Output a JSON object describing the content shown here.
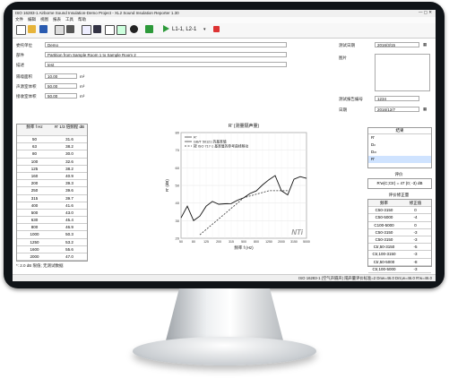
{
  "window": {
    "title": "ISO 16283-1 Airborne Sound Insulation-Demo Project - XL2 Sound Insulation Reporter 1.30"
  },
  "menu": [
    "文件",
    "编辑",
    "视图",
    "报表",
    "工具",
    "帮助"
  ],
  "toolbar": {
    "pair_label": "L1-1, L2-1"
  },
  "form": {
    "org_label": "委托单位",
    "org_value": "Demo",
    "part_label": "部件",
    "part_value": "Partition from Sample Room 1 to Sample Room 2",
    "note_label": "描述",
    "note_value": "test",
    "area_label": "隔墙面积",
    "area_value": "10.00",
    "area_unit": "m²",
    "src_vol_label": "声源室体积",
    "src_vol_value": "50.00",
    "src_vol_unit": "m³",
    "rcv_vol_label": "接收室体积",
    "rcv_vol_value": "50.00",
    "rcv_vol_unit": "m³",
    "test_date_label": "测试日期",
    "test_date_value": "2016/3/15",
    "image_label": "图片",
    "report_no_label": "测试报告编号",
    "report_no_value": "1234",
    "report_date_label": "日期",
    "report_date_value": "2016/12/7"
  },
  "freq_table": {
    "headers": [
      "频率 f Hz",
      "R' 1/3 倍频程 dB"
    ],
    "rows": [
      [
        "50",
        "31.6"
      ],
      [
        "63",
        "38.2"
      ],
      [
        "80",
        "30.0"
      ],
      [
        "100",
        "32.6"
      ],
      [
        "125",
        "38.2"
      ],
      [
        "160",
        "40.9"
      ],
      [
        "200",
        "39.3"
      ],
      [
        "250",
        "39.6"
      ],
      [
        "315",
        "39.7"
      ],
      [
        "400",
        "41.6"
      ],
      [
        "500",
        "43.0"
      ],
      [
        "630",
        "45.4"
      ],
      [
        "800",
        "46.9"
      ],
      [
        "1000",
        "50.3"
      ],
      [
        "1250",
        "53.2"
      ],
      [
        "1600",
        "55.6"
      ],
      [
        "2000",
        "47.0"
      ],
      [
        "2500",
        "44.6"
      ]
    ],
    "footnote": "*: 2.0 dB 限值; 无测试数据"
  },
  "chart_data": {
    "type": "line",
    "title": "R' (测量隔声量)",
    "xlabel": "频率 f (Hz)",
    "ylabel": "R' (dB)",
    "categories": [
      "50",
      "63",
      "80",
      "100",
      "125",
      "160",
      "200",
      "250",
      "315",
      "400",
      "500",
      "630",
      "800",
      "1000",
      "1250",
      "1600",
      "2000",
      "2500",
      "3150",
      "4000",
      "5000"
    ],
    "ylim": [
      20,
      80
    ],
    "series": [
      {
        "name": "R'",
        "values": [
          31.6,
          38.2,
          30.0,
          32.6,
          38.2,
          40.9,
          39.3,
          39.6,
          39.7,
          41.6,
          43.0,
          45.4,
          46.9,
          50.3,
          53.2,
          55.6,
          47.0,
          44.6,
          53.5,
          55.0,
          54.0
        ]
      },
      {
        "name": "ISO 717-1 基准值的参考曲线移动",
        "values": [
          null,
          null,
          null,
          22,
          25,
          28,
          31,
          34,
          37,
          40,
          43,
          44,
          45,
          46,
          47,
          47,
          47,
          47,
          null,
          null,
          null
        ]
      }
    ],
    "legend": [
      "R'",
      "GB/T 50121 的基准值",
      "按 ISO 717-1 基准值的参考曲线移动"
    ],
    "watermark": "NTi",
    "legend_position": "top-left"
  },
  "result": {
    "head": "结果",
    "items": [
      "R'",
      "Dₙ",
      "Dₙₜ",
      "R'"
    ],
    "eval_head": "评价",
    "eval_value": "R'w(C;Ctr) = 47 (0; -3) dB"
  },
  "adapt": {
    "head": "评价修正量",
    "col1": "频率",
    "col2": "修正值",
    "rows": [
      [
        "C50-3150",
        "0"
      ],
      [
        "C50-5000",
        "-4"
      ],
      [
        "C100-5000",
        "0"
      ],
      [
        "C50-3150",
        "-3"
      ],
      [
        "C50-3150",
        "-3"
      ],
      [
        "Ctr,50-3150",
        "-5"
      ],
      [
        "Ctr,100-3150",
        "-3"
      ],
      [
        "Ctr,50-5000",
        "-8"
      ],
      [
        "Ctr,100-5000",
        "-3"
      ]
    ]
  },
  "status": {
    "text": "ISO 16283-1 (空气声隔声)   隔声量评价标准=2   Dnw=46.0   Dnt,w=46.0   R'w=46.0"
  }
}
